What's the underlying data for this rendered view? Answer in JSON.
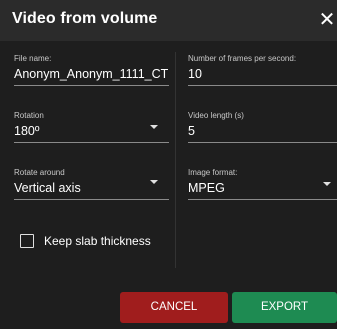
{
  "dialog": {
    "title": "Video from volume",
    "close_glyph": "✕",
    "fields": {
      "file_name": {
        "label": "File name:",
        "value": "Anonym_Anonym_1111_CT"
      },
      "frames_per_second": {
        "label": "Number of frames per second:",
        "value": "10"
      },
      "rotation": {
        "label": "Rotation",
        "value": "180º"
      },
      "video_length": {
        "label": "Video length (s)",
        "value": "5"
      },
      "rotate_around": {
        "label": "Rotate around",
        "value": "Vertical axis"
      },
      "image_format": {
        "label": "Image format:",
        "value": "MPEG"
      }
    },
    "keep_slab_thickness": {
      "label": "Keep slab thickness",
      "checked": false
    },
    "buttons": {
      "cancel": "CANCEL",
      "export": "EXPORT"
    }
  },
  "colors": {
    "cancel": "#a01d1d",
    "export": "#1e8b52",
    "background": "#1e1e1e",
    "title_bar": "#2b2b2b"
  },
  "icons": [
    "close-icon",
    "dropdown-caret-icon",
    "checkbox-icon"
  ]
}
